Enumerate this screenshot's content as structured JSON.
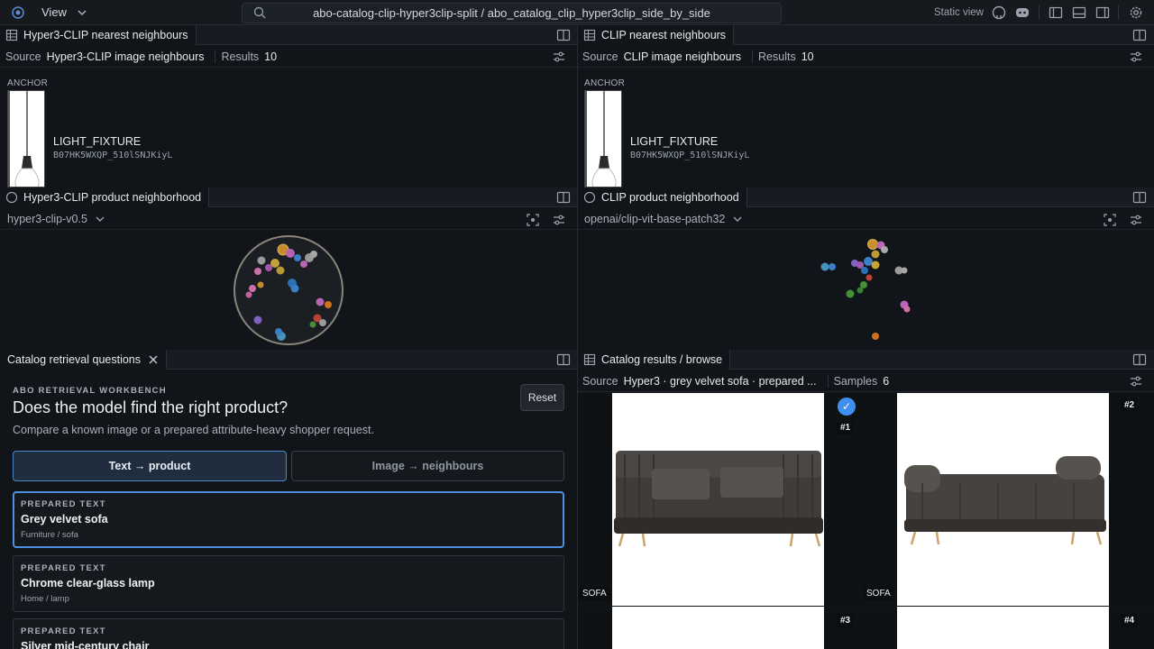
{
  "topbar": {
    "view_label": "View",
    "path": "abo-catalog-clip-hyper3clip-split / abo_catalog_clip_hyper3clip_side_by_side",
    "static_view": "Static view"
  },
  "left_nn": {
    "tab": "Hyper3-CLIP nearest neighbours",
    "source_label": "Source",
    "source_value": "Hyper3-CLIP image neighbours",
    "results_label": "Results",
    "results_value": "10",
    "anchor_label": "ANCHOR",
    "category": "LIGHT_FIXTURE",
    "sku": "B07HK5WXQP_510lSNJKiyL"
  },
  "right_nn": {
    "tab": "CLIP nearest neighbours",
    "source_label": "Source",
    "source_value": "CLIP image neighbours",
    "results_label": "Results",
    "results_value": "10",
    "anchor_label": "ANCHOR",
    "category": "LIGHT_FIXTURE",
    "sku": "B07HK5WXQP_510lSNJKiyL"
  },
  "left_hood": {
    "tab": "Hyper3-CLIP product neighborhood",
    "model": "hyper3-clip-v0.5"
  },
  "right_hood": {
    "tab": "CLIP product neighborhood",
    "model": "openai/clip-vit-base-patch32"
  },
  "questions": {
    "tab": "Catalog retrieval questions",
    "eyebrow": "ABO RETRIEVAL WORKBENCH",
    "title": "Does the model find the right product?",
    "description": "Compare a known image or a prepared attribute-heavy shopper request.",
    "reset": "Reset",
    "mode_text": "Text → product",
    "mode_image": "Image → neighbours",
    "cards": [
      {
        "eyebrow": "PREPARED TEXT",
        "title": "Grey velvet sofa",
        "sub": "Furniture / sofa"
      },
      {
        "eyebrow": "PREPARED TEXT",
        "title": "Chrome clear-glass lamp",
        "sub": "Home / lamp"
      },
      {
        "eyebrow": "PREPARED TEXT",
        "title": "Silver mid-century chair",
        "sub": ""
      }
    ]
  },
  "results": {
    "tab": "Catalog results / browse",
    "source_label": "Source",
    "source_value": "Hyper3 · grey velvet sofa · prepared ...",
    "samples_label": "Samples",
    "samples_value": "6",
    "items": [
      {
        "rank": "#1",
        "category": "SOFA"
      },
      {
        "rank": "#2",
        "category": "SOFA"
      },
      {
        "rank": "#3",
        "category": ""
      },
      {
        "rank": "#4",
        "category": ""
      }
    ]
  },
  "colors": {
    "accent": "#3f8ef0",
    "selected_border": "#4c8ee0",
    "background": "#111418"
  }
}
